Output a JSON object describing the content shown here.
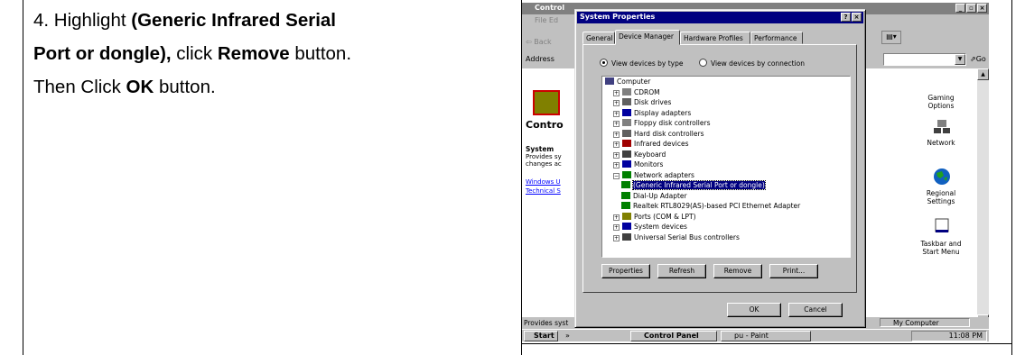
{
  "instruction": {
    "line1_plain": "4. Highlight ",
    "line1_bold": "(Generic Infrared Serial",
    "line2_bold": "Port or dongle),",
    "line2_plain1": " click ",
    "line2_bold2": "Remove",
    "line2_plain2": " button.",
    "line3_plain1": "Then Click ",
    "line3_bold": "OK",
    "line3_plain2": " button."
  },
  "control_panel": {
    "title": "Control",
    "menu": "File  Ed",
    "toolbar_back": "⇦ Back",
    "address_label": "Address",
    "go_label": "Go",
    "heading": "Contro",
    "system_heading": "System",
    "system_desc1": "Provides sy",
    "system_desc2": "changes ac",
    "link_windows_update": "Windows U",
    "link_technical": "Technical S",
    "right_items": [
      "Gaming Options",
      "Network",
      "Regional Settings",
      "Taskbar and Start Menu"
    ],
    "status_left": "Provides syst",
    "status_right": "My Computer"
  },
  "taskbar": {
    "start": "Start",
    "quick": "» ",
    "task1": "Control Panel",
    "task2": "pu - Paint",
    "clock": "11:08 PM"
  },
  "dialog": {
    "title": "System Properties",
    "tabs": [
      "General",
      "Device Manager",
      "Hardware Profiles",
      "Performance"
    ],
    "radio_type": "View devices by type",
    "radio_connection": "View devices by connection",
    "tree": [
      {
        "label": "Computer",
        "level": 0,
        "expander": ""
      },
      {
        "label": "CDROM",
        "level": 1,
        "expander": "+"
      },
      {
        "label": "Disk drives",
        "level": 1,
        "expander": "+"
      },
      {
        "label": "Display adapters",
        "level": 1,
        "expander": "+"
      },
      {
        "label": "Floppy disk controllers",
        "level": 1,
        "expander": "+"
      },
      {
        "label": "Hard disk controllers",
        "level": 1,
        "expander": "+"
      },
      {
        "label": "Infrared devices",
        "level": 1,
        "expander": "+"
      },
      {
        "label": "Keyboard",
        "level": 1,
        "expander": "+"
      },
      {
        "label": "Monitors",
        "level": 1,
        "expander": "+"
      },
      {
        "label": "Network adapters",
        "level": 1,
        "expander": "−"
      },
      {
        "label": "(Generic Infrared Serial Port or dongle)",
        "level": 2,
        "expander": "",
        "selected": true
      },
      {
        "label": "Dial-Up Adapter",
        "level": 2,
        "expander": ""
      },
      {
        "label": "Realtek RTL8029(AS)-based PCI Ethernet Adapter",
        "level": 2,
        "expander": ""
      },
      {
        "label": "Ports (COM & LPT)",
        "level": 1,
        "expander": "+"
      },
      {
        "label": "System devices",
        "level": 1,
        "expander": "+"
      },
      {
        "label": "Universal Serial Bus controllers",
        "level": 1,
        "expander": "+"
      }
    ],
    "buttons": {
      "properties": "Properties",
      "refresh": "Refresh",
      "remove": "Remove",
      "print": "Print...",
      "ok": "OK",
      "cancel": "Cancel"
    }
  }
}
